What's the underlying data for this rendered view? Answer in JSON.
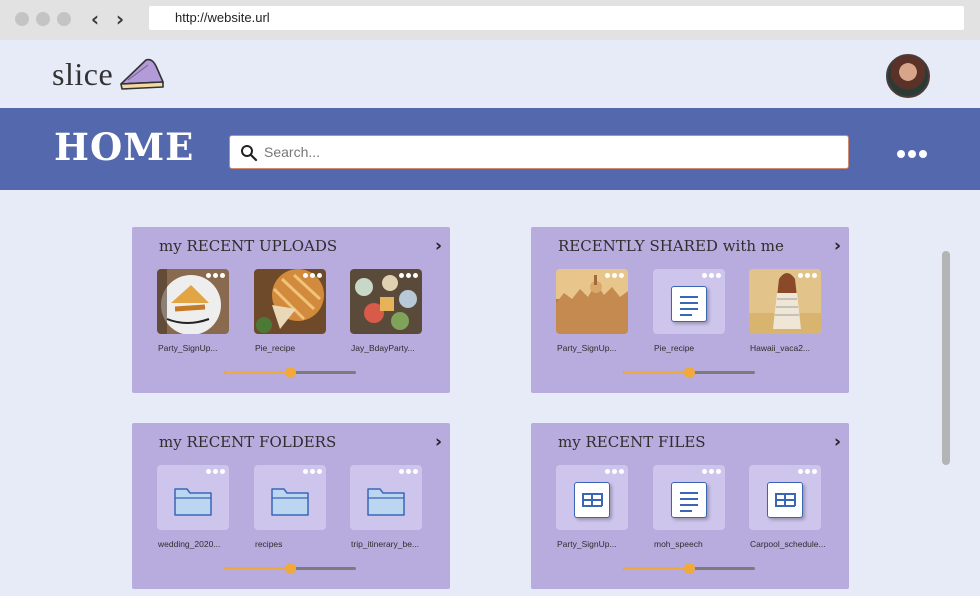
{
  "browser": {
    "url": "http://website.url",
    "back_icon": "chevron-left-icon",
    "forward_icon": "chevron-right-icon"
  },
  "app": {
    "logo_text": "slice",
    "logo_icon": "pie-slice-icon",
    "avatar_icon": "user-avatar"
  },
  "header": {
    "title": "HOME",
    "search_placeholder": "Search...",
    "more_icon": "more-dots-icon"
  },
  "cards": [
    {
      "title": "my RECENT UPLOADS",
      "items": [
        {
          "label": "Party_SignUp...",
          "kind": "photo-pie"
        },
        {
          "label": "Pie_recipe",
          "kind": "photo-pie2"
        },
        {
          "label": "Jay_BdayParty...",
          "kind": "photo-party"
        }
      ],
      "slider_value": 0.5
    },
    {
      "title": "RECENTLY SHARED with me",
      "items": [
        {
          "label": "Party_SignUp...",
          "kind": "photo-city"
        },
        {
          "label": "Pie_recipe",
          "kind": "document"
        },
        {
          "label": "Hawaii_vaca2...",
          "kind": "photo-person"
        }
      ],
      "slider_value": 0.5
    },
    {
      "title": "my RECENT FOLDERS",
      "items": [
        {
          "label": "wedding_2020...",
          "kind": "folder"
        },
        {
          "label": "recipes",
          "kind": "folder"
        },
        {
          "label": "trip_itinerary_be...",
          "kind": "folder"
        }
      ],
      "slider_value": 0.5
    },
    {
      "title": "my RECENT FILES",
      "items": [
        {
          "label": "Party_SignUp...",
          "kind": "spreadsheet"
        },
        {
          "label": "moh_speech",
          "kind": "document"
        },
        {
          "label": "Carpool_schedule...",
          "kind": "spreadsheet"
        }
      ],
      "slider_value": 0.5
    }
  ],
  "colors": {
    "page_bg": "#e6ebf7",
    "header_bar": "#5468ad",
    "card_bg": "#b8abde",
    "tile_bg": "#cec5ec",
    "slider_accent": "#f2a93b",
    "icon_blue": "#3a66b5"
  }
}
